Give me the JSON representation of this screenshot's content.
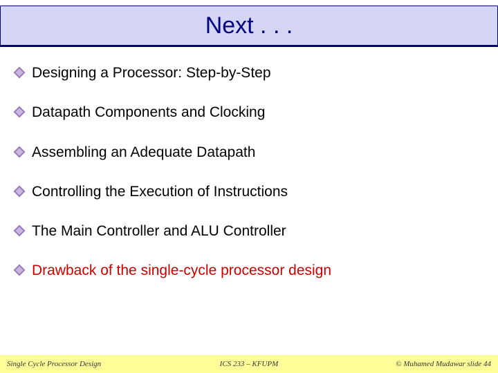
{
  "title": "Next . . .",
  "bullets": [
    {
      "text": "Designing a Processor: Step-by-Step",
      "highlight": false
    },
    {
      "text": "Datapath Components and Clocking",
      "highlight": false
    },
    {
      "text": "Assembling an Adequate Datapath",
      "highlight": false
    },
    {
      "text": "Controlling the Execution of Instructions",
      "highlight": false
    },
    {
      "text": "The Main Controller and ALU Controller",
      "highlight": false
    },
    {
      "text": "Drawback of the single-cycle processor design",
      "highlight": true
    }
  ],
  "footer": {
    "left": "Single Cycle Processor Design",
    "center": "ICS 233 – KFUPM",
    "right": "© Muhamed Mudawar slide 44"
  }
}
